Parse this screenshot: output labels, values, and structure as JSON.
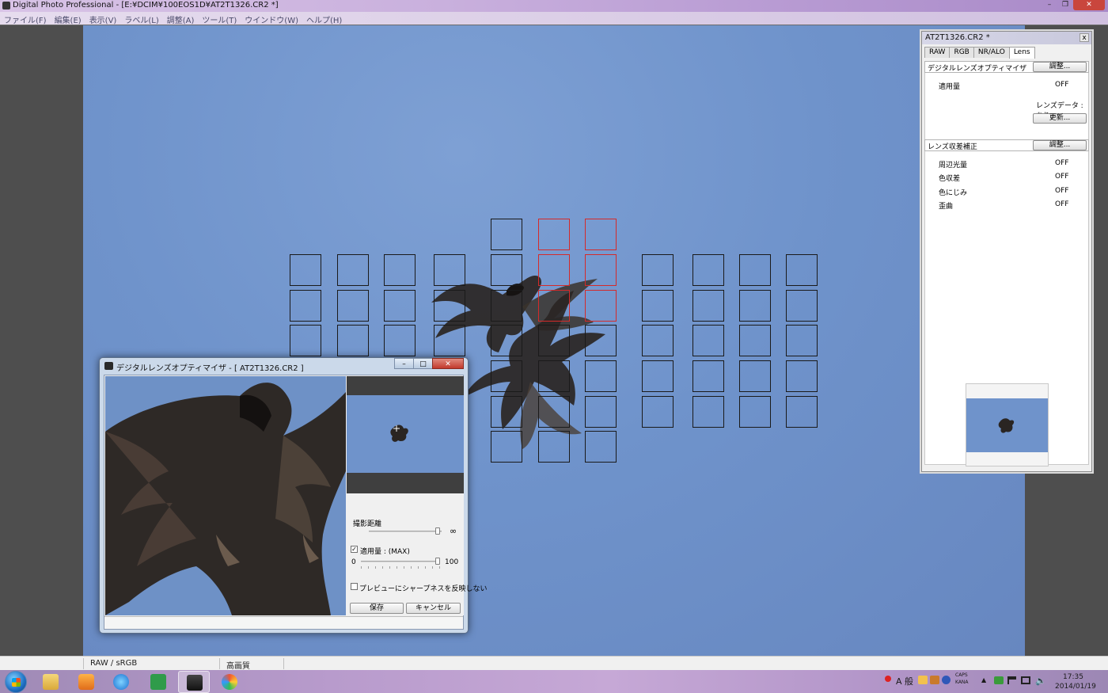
{
  "window": {
    "title": "Digital Photo Professional - [E:¥DCIM¥100EOS1D¥AT2T1326.CR2 *]",
    "controls": [
      "–",
      "❐",
      "✕"
    ]
  },
  "menu": [
    "ファイル(F)",
    "編集(E)",
    "表示(V)",
    "ラベル(L)",
    "調整(A)",
    "ツール(T)",
    "ウインドウ(W)",
    "ヘルプ(H)"
  ],
  "status": {
    "color_space": "RAW / sRGB",
    "quality": "高画質"
  },
  "palette": {
    "title": "AT2T1326.CR2 *",
    "close": "x",
    "tabs": [
      "RAW",
      "RGB",
      "NR/ALO",
      "Lens"
    ],
    "dlo_section": {
      "label": "デジタルレンズオプティマイザ",
      "adjust_button": "調整...",
      "amount_label": "適用量",
      "amount_value": "OFF",
      "lens_data": "レンズデータ : あり",
      "update_button": "更新..."
    },
    "aberration_section": {
      "label": "レンズ収差補正",
      "adjust_button": "調整...",
      "items": [
        {
          "label": "周辺光量",
          "value": "OFF"
        },
        {
          "label": "色収差",
          "value": "OFF"
        },
        {
          "label": "色にじみ",
          "value": "OFF"
        },
        {
          "label": "歪曲",
          "value": "OFF"
        }
      ]
    }
  },
  "dlo_dialog": {
    "title": "デジタルレンズオプティマイザ - [ AT2T1326.CR2 ]",
    "controls": [
      "–",
      "□",
      "✕"
    ],
    "distance_label": "撮影距離",
    "distance_end": "∞",
    "amount_checkbox": "適用量 : (MAX)",
    "amount_checked": true,
    "amount_min": "0",
    "amount_max": "100",
    "amount_value_fraction": 1.0,
    "sharpness_checkbox": "プレビューにシャープネスを反映しない",
    "sharpness_checked": false,
    "save_button": "保存",
    "cancel_button": "キャンセル"
  },
  "taskbar": {
    "tray_text": "A 般",
    "caps": "CAPS",
    "kana": "KANA",
    "time": "17:35",
    "date": "2014/01/19"
  }
}
